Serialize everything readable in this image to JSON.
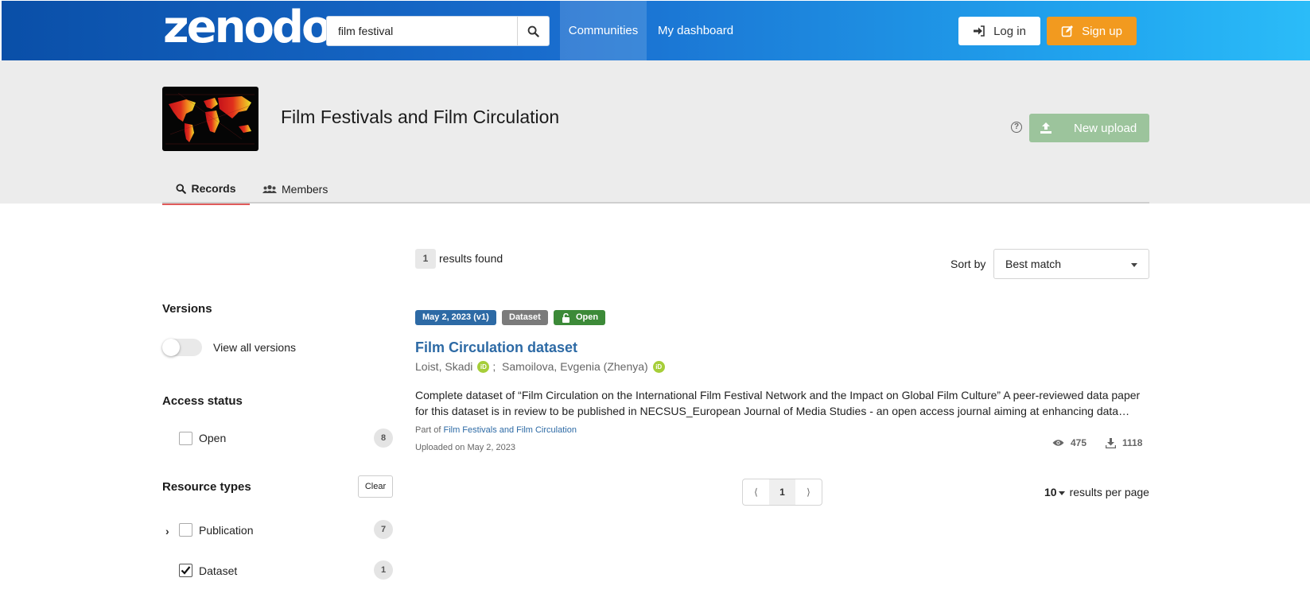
{
  "header": {
    "logo_text": "zenodo",
    "search_value": "film festival",
    "nav_communities": "Communities",
    "nav_dashboard": "My dashboard",
    "login_label": "Log in",
    "signup_label": "Sign up"
  },
  "community": {
    "title": "Film Festivals and Film Circulation",
    "help_glyph": "?",
    "new_upload_label": "New upload",
    "tabs": [
      {
        "label": "Records",
        "icon": "search-icon"
      },
      {
        "label": "Members",
        "icon": "users-icon"
      }
    ]
  },
  "sidebar": {
    "versions_heading": "Versions",
    "view_all_versions": "View all versions",
    "access_heading": "Access status",
    "access_items": [
      {
        "label": "Open",
        "count": "8"
      }
    ],
    "resource_heading": "Resource types",
    "clear_label": "Clear",
    "resource_items": [
      {
        "label": "Publication",
        "count": "7",
        "checked": false
      },
      {
        "label": "Dataset",
        "count": "1",
        "checked": true
      }
    ]
  },
  "results": {
    "count": "1",
    "found_label": "results found",
    "sort_label": "Sort by",
    "sort_value": "Best match",
    "record": {
      "date_badge": "May 2, 2023 (v1)",
      "type_badge": "Dataset",
      "access_badge": "Open",
      "title": "Film Circulation dataset",
      "author_1": "Loist, Skadi",
      "author_2": "Samoilova, Evgenia (Zhenya)",
      "orcid_text": "iD",
      "description": "Complete dataset of “Film Circulation on the International Film Festival Network and the Impact on Global Film Culture”   A peer-reviewed data paper for this dataset is in review to be published in NECSUS_European Journal of Media Studies - an open access journal aiming at enhancing data…",
      "part_of_label": "Part of",
      "part_of_link": "Film Festivals and Film Circulation",
      "uploaded": "Uploaded on May 2, 2023",
      "views": "475",
      "downloads": "1118"
    },
    "pager": {
      "prev": "⟨",
      "page": "1",
      "next": "⟩"
    },
    "per_page_value": "10",
    "per_page_label": "results per page"
  },
  "colors": {
    "accent_blue": "#2d6aa5",
    "signup_orange": "#f29a1f",
    "upload_green": "#9cc49c",
    "open_green": "#3c8a38"
  }
}
